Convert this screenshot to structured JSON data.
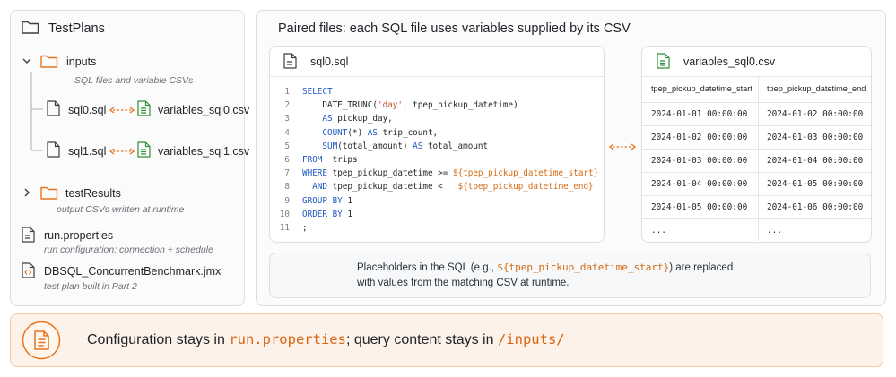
{
  "tree": {
    "root": "TestPlans",
    "inputs": {
      "label": "inputs",
      "caption": "SQL files and variable CSVs",
      "pairs": [
        {
          "sql": "sql0.sql",
          "csv": "variables_sql0.csv"
        },
        {
          "sql": "sql1.sql",
          "csv": "variables_sql1.csv"
        }
      ]
    },
    "results": {
      "label": "testResults",
      "caption": "output CSVs written at runtime"
    },
    "props": {
      "label": "run.properties",
      "caption": "run configuration: connection + schedule"
    },
    "jmx": {
      "label": "DBSQL_ConcurrentBenchmark.jmx",
      "caption": "test plan built in Part 2"
    }
  },
  "main": {
    "title": "Paired files: each SQL file uses variables supplied by its CSV",
    "sql_file": {
      "name": "sql0.sql",
      "lines": [
        [
          {
            "t": "SELECT",
            "c": "kw"
          }
        ],
        [
          {
            "t": "    DATE_TRUNC(",
            "c": ""
          },
          {
            "t": "'day'",
            "c": "str"
          },
          {
            "t": ", tpep_pickup_datetime)",
            "c": ""
          }
        ],
        [
          {
            "t": "    ",
            "c": ""
          },
          {
            "t": "AS",
            "c": "kw"
          },
          {
            "t": " pickup_day,",
            "c": ""
          }
        ],
        [
          {
            "t": "    ",
            "c": ""
          },
          {
            "t": "COUNT",
            "c": "kw"
          },
          {
            "t": "(*) ",
            "c": ""
          },
          {
            "t": "AS",
            "c": "kw"
          },
          {
            "t": " trip_count,",
            "c": ""
          }
        ],
        [
          {
            "t": "    ",
            "c": ""
          },
          {
            "t": "SUM",
            "c": "kw"
          },
          {
            "t": "(total_amount) ",
            "c": ""
          },
          {
            "t": "AS",
            "c": "kw"
          },
          {
            "t": " total_amount",
            "c": ""
          }
        ],
        [
          {
            "t": "FROM",
            "c": "kw"
          },
          {
            "t": "  trips",
            "c": ""
          }
        ],
        [
          {
            "t": "WHERE",
            "c": "kw"
          },
          {
            "t": " tpep_pickup_datetime >= ",
            "c": ""
          },
          {
            "t": "${tpep_pickup_datetime_start}",
            "c": "var"
          }
        ],
        [
          {
            "t": "  ",
            "c": ""
          },
          {
            "t": "AND",
            "c": "kw"
          },
          {
            "t": " tpep_pickup_datetime <   ",
            "c": ""
          },
          {
            "t": "${tpep_pickup_datetime_end}",
            "c": "var"
          }
        ],
        [
          {
            "t": "GROUP BY",
            "c": "kw"
          },
          {
            "t": " 1",
            "c": ""
          }
        ],
        [
          {
            "t": "ORDER BY",
            "c": "kw"
          },
          {
            "t": " 1",
            "c": ""
          }
        ],
        [
          {
            "t": ";",
            "c": ""
          }
        ]
      ]
    },
    "csv_file": {
      "name": "variables_sql0.csv",
      "headers": [
        "tpep_pickup_datetime_start",
        "tpep_pickup_datetime_end"
      ],
      "rows": [
        [
          "2024-01-01 00:00:00",
          "2024-01-02 00:00:00"
        ],
        [
          "2024-01-02 00:00:00",
          "2024-01-03 00:00:00"
        ],
        [
          "2024-01-03 00:00:00",
          "2024-01-04 00:00:00"
        ],
        [
          "2024-01-04 00:00:00",
          "2024-01-05 00:00:00"
        ],
        [
          "2024-01-05 00:00:00",
          "2024-01-06 00:00:00"
        ],
        [
          "...",
          "..."
        ]
      ]
    },
    "note": {
      "line1_pre": "Placeholders in the SQL (e.g., ",
      "line1_code": "${tpep_pickup_datetime_start}",
      "line1_post": ") are replaced",
      "line2": "with values from the matching CSV at runtime."
    }
  },
  "banner": {
    "pre": "Configuration stays in ",
    "code1": "run.properties",
    "mid": "; query content stays in ",
    "code2": "/inputs/"
  },
  "colors": {
    "accent": "#e8741e",
    "csv_green": "#2f8f3a",
    "keyword": "#1f57c3"
  }
}
